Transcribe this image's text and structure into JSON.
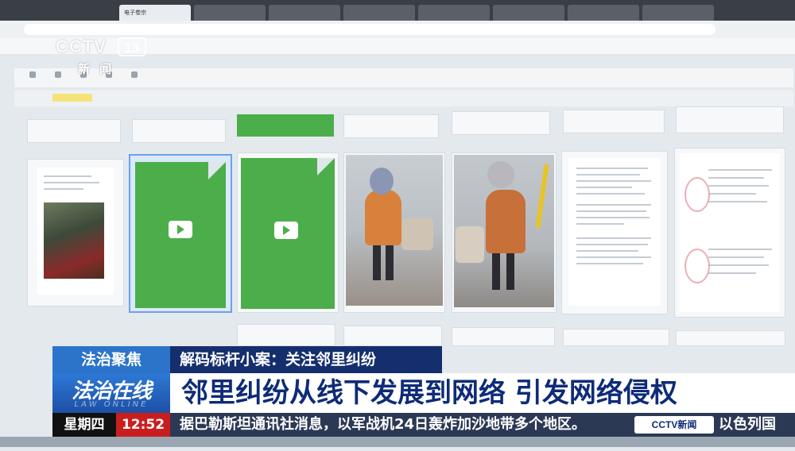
{
  "browser": {
    "tabs": [
      "电子卷宗",
      "",
      "",
      "",
      "",
      "",
      "",
      "",
      ""
    ],
    "url": "",
    "bookmarks": []
  },
  "app": {
    "toolbar_buttons": [],
    "grid": {
      "cards": [
        {
          "kind": "document-photo"
        },
        {
          "kind": "video-file",
          "selected": true
        },
        {
          "kind": "video-file",
          "selected": false
        },
        {
          "kind": "photo"
        },
        {
          "kind": "photo"
        },
        {
          "kind": "document"
        },
        {
          "kind": "document-stamped"
        }
      ]
    }
  },
  "overlay": {
    "channel_logo": "CCTV",
    "channel_number": "13",
    "channel_sub": "新闻",
    "program_tag": "法治聚焦",
    "sub_banner": "解码标杆小案：关注邻里纠纷",
    "show_title": "法治在线",
    "show_title_en": "LAW ONLINE",
    "headline": "邻里纠纷从线下发展到网络 引发网络侵权",
    "weekday": "星期四",
    "time": "12:52",
    "ticker_text": "据巴勒斯坦通讯社消息，以军战机24日轰炸加沙地带多个地区。",
    "ticker_logo": "CCTV新闻",
    "ticker_text_next": "以色列国"
  },
  "colors": {
    "tag_blue": "#2b74c9",
    "banner_navy": "#152f6e",
    "headline_text": "#0e2b78",
    "time_red": "#ca1e1e",
    "video_green": "#4cae4a",
    "selection_blue": "#6aa2e8"
  }
}
